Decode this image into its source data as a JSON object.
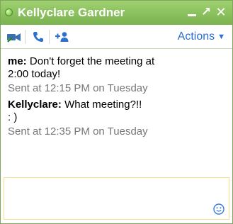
{
  "window": {
    "title": "Kellyclare Gardner",
    "controls": {
      "minimize": "_",
      "popout": "↗",
      "close": "✕"
    }
  },
  "toolbar": {
    "video_icon": "video-camera-icon",
    "call_icon": "phone-icon",
    "add_icon": "add-person-icon",
    "actions_label": "Actions",
    "actions_arrow": "▼"
  },
  "messages": [
    {
      "sender": "me:",
      "line1": "Don't forget the meeting at",
      "line2": "2:00 today!",
      "stamp": "Sent at 12:15 PM on Tuesday"
    },
    {
      "sender": "Kellyclare:",
      "line1": "What meeting?!!",
      "line2": ": )",
      "stamp": "Sent at 12:35 PM on Tuesday"
    }
  ],
  "compose": {
    "value": "",
    "emoticon_icon": "smiley-icon"
  },
  "colors": {
    "title_bar": "#8cc45f",
    "link": "#2a6fd1",
    "timestamp": "#777777",
    "compose_border": "#f1e08c"
  }
}
